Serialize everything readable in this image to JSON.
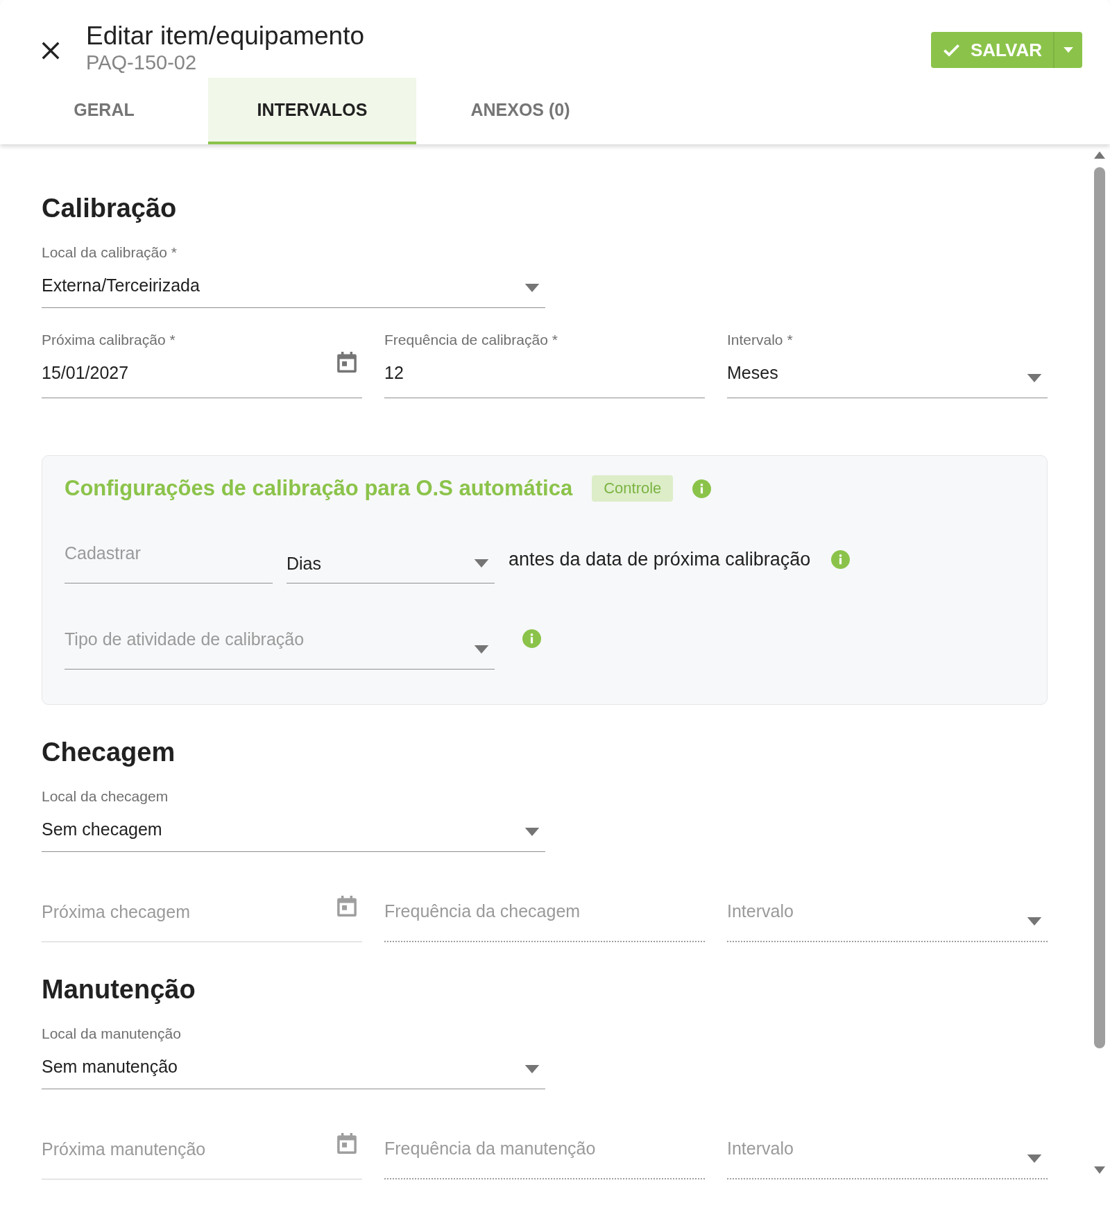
{
  "header": {
    "title": "Editar item/equipamento",
    "subtitle": "PAQ-150-02",
    "save_label": "SALVAR"
  },
  "tabs": [
    {
      "label": "GERAL",
      "selected": false
    },
    {
      "label": "INTERVALOS",
      "selected": true
    },
    {
      "label": "ANEXOS (0)",
      "selected": false
    }
  ],
  "sections": [
    {
      "title": "Calibração",
      "location": {
        "label": "Local da calibração *",
        "value": "Externa/Terceirizada"
      },
      "fields": [
        {
          "kind": "date",
          "label": "Próxima calibração *",
          "value": "15/01/2027",
          "disabled": false
        },
        {
          "kind": "text",
          "label": "Frequência de calibração *",
          "value": "12",
          "disabled": false
        },
        {
          "kind": "select",
          "label": "Intervalo *",
          "value": "Meses",
          "disabled": false
        }
      ],
      "auto_config": {
        "title": "Configurações de calibração para O.S automática",
        "badge": "Controle",
        "lead_field": {
          "placeholder": "Cadastrar"
        },
        "unit_field": {
          "value": "Dias"
        },
        "note": "antes da data de próxima calibração",
        "activity_field": {
          "placeholder": "Tipo de atividade de calibração"
        }
      }
    },
    {
      "title": "Checagem",
      "location": {
        "label": "Local da checagem",
        "value": "Sem checagem"
      },
      "fields": [
        {
          "kind": "date",
          "placeholder": "Próxima checagem",
          "disabled": true
        },
        {
          "kind": "text",
          "placeholder": "Frequência da checagem",
          "disabled": true
        },
        {
          "kind": "select",
          "placeholder": "Intervalo",
          "disabled": true
        }
      ]
    },
    {
      "title": "Manutenção",
      "location": {
        "label": "Local da manutenção",
        "value": "Sem manutenção"
      },
      "fields": [
        {
          "kind": "date",
          "placeholder": "Próxima manutenção",
          "disabled": true
        },
        {
          "kind": "text",
          "placeholder": "Frequência da manutenção",
          "disabled": true
        },
        {
          "kind": "select",
          "placeholder": "Intervalo",
          "disabled": true
        }
      ]
    }
  ]
}
